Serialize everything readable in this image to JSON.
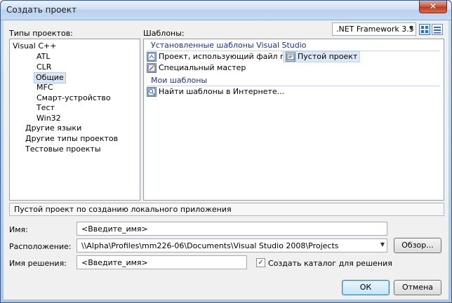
{
  "window": {
    "title": "Создать проект",
    "close_glyph": "✕"
  },
  "labels": {
    "project_types": "Типы проектов:",
    "templates": "Шаблоны:",
    "name": "Имя:",
    "location": "Расположение:",
    "solution_name": "Имя решения:"
  },
  "framework": {
    "selected": ".NET Framework 3.5",
    "arrow": "▼"
  },
  "tree": {
    "items": [
      {
        "label": "Visual C++",
        "level": 0,
        "expand": "−"
      },
      {
        "label": "ATL",
        "level": 1
      },
      {
        "label": "CLR",
        "level": 1
      },
      {
        "label": "Общие",
        "level": 1,
        "selected": true
      },
      {
        "label": "MFC",
        "level": 1
      },
      {
        "label": "Смарт-устройство",
        "level": 1
      },
      {
        "label": "Тест",
        "level": 1
      },
      {
        "label": "Win32",
        "level": 1
      },
      {
        "label": "Другие языки",
        "level": 0,
        "expand": "+"
      },
      {
        "label": "Другие типы проектов",
        "level": 0,
        "expand": "+"
      },
      {
        "label": "Тестовые проекты",
        "level": 0,
        "expand": "+"
      }
    ]
  },
  "templates": {
    "installed_header": "Установленные шаблоны Visual Studio",
    "installed": [
      {
        "label": "Проект, использующий файл makefile"
      },
      {
        "label": "Пустой проект",
        "selected": true
      },
      {
        "label": "Специальный мастер"
      }
    ],
    "my_header": "Мои шаблоны",
    "my": [
      {
        "label": "Найти шаблоны в Интернете..."
      }
    ]
  },
  "description": "Пустой проект по созданию локального приложения",
  "fields": {
    "name_value": "<Введите_имя>",
    "location_value": "\\\\Alpha\\Profiles\\mm226-06\\Documents\\Visual Studio 2008\\Projects",
    "solution_value": "<Введите_имя>"
  },
  "create_dir": {
    "label": "Создать каталог для решения",
    "checked": true,
    "check_glyph": "✓"
  },
  "buttons": {
    "browse": "Обзор...",
    "ok": "ОК",
    "cancel": "Отмена"
  },
  "colors": {
    "group_header": "#1e3287",
    "selection": "#d9e6f5"
  }
}
